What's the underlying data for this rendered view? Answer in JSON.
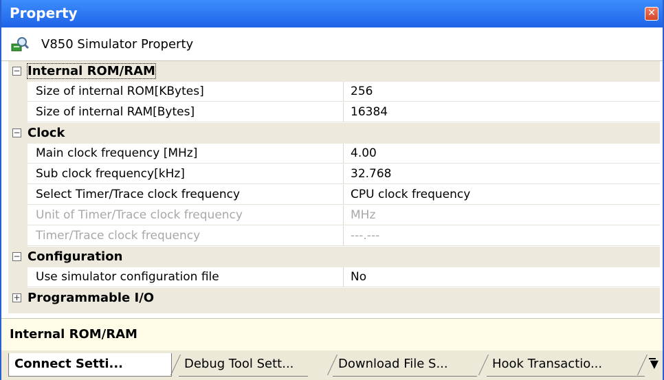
{
  "window": {
    "title": "Property",
    "close_glyph": "✕"
  },
  "header": {
    "icon": "simulator-property-icon",
    "title": "V850 Simulator Property"
  },
  "categories": [
    {
      "label": "Internal ROM/RAM",
      "expanded": true,
      "rows": [
        {
          "name": "Size of internal ROM[KBytes]",
          "value": "256",
          "enabled": true
        },
        {
          "name": "Size of internal RAM[Bytes]",
          "value": "16384",
          "enabled": true
        }
      ]
    },
    {
      "label": "Clock",
      "expanded": true,
      "rows": [
        {
          "name": "Main clock frequency [MHz]",
          "value": "4.00",
          "enabled": true
        },
        {
          "name": "Sub clock frequency[kHz]",
          "value": "32.768",
          "enabled": true
        },
        {
          "name": "Select Timer/Trace clock frequency",
          "value": "CPU clock frequency",
          "enabled": true
        },
        {
          "name": "Unit of Timer/Trace clock frequency",
          "value": "MHz",
          "enabled": false
        },
        {
          "name": "Timer/Trace clock frequency",
          "value": "---.---",
          "enabled": false
        }
      ]
    },
    {
      "label": "Configuration",
      "expanded": true,
      "rows": [
        {
          "name": "Use simulator configuration file",
          "value": "No",
          "enabled": true
        }
      ]
    },
    {
      "label": "Programmable I/O",
      "expanded": false,
      "rows": []
    }
  ],
  "expand_glyphs": {
    "expanded": "−",
    "collapsed": "+"
  },
  "description": "Internal ROM/RAM",
  "tabs": [
    {
      "label": "Connect Setti...",
      "active": true
    },
    {
      "label": "Debug Tool Sett...",
      "active": false
    },
    {
      "label": "Download File S...",
      "active": false
    },
    {
      "label": "Hook Transactio...",
      "active": false
    }
  ],
  "tab_overflow_glyph": "▼",
  "colors": {
    "title_bar": "#1f63e8",
    "category_bg": "#ede9dc",
    "description_bg": "#fffde8",
    "disabled_text": "#a8a8a8"
  }
}
